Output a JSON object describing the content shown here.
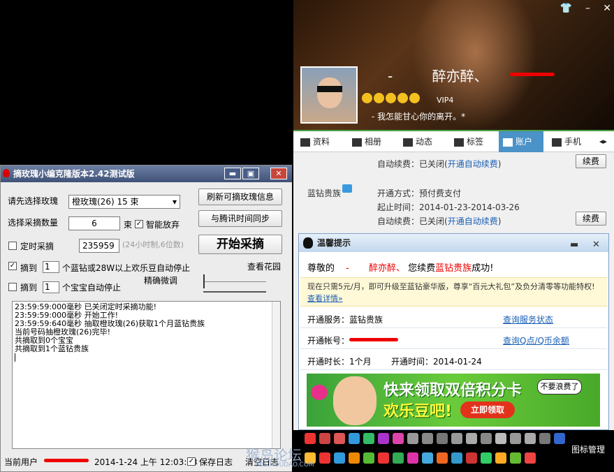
{
  "tool": {
    "title": "摘玫瑰小编克隆版本2.42测试版",
    "select_rose_label": "请先选择玫瑰",
    "select_rose_value": "橙玫瑰(26) 15 束",
    "refresh_button": "刷新可摘玫瑰信息",
    "quantity_label": "选择采摘数量",
    "quantity_value": "6",
    "quantity_unit": "束",
    "smart_give_up": "智能放弃",
    "sync_button": "与腾讯时间同步",
    "timed_pick_label": "定时采摘",
    "timed_value": "235959",
    "timed_hint": "(24小时制,6位数)",
    "start_button": "开始采摘",
    "stop1_prefix": "摘到",
    "stop1_value": "1",
    "stop1_text": "个蓝钻或28W以上欢乐豆自动停止",
    "view_garden": "查看花园",
    "stop2_prefix": "摘到",
    "stop2_value": "1",
    "stop2_text": "个宝宝自动停止",
    "fine_tune": "精确微调",
    "log": [
      "23:59:59:000毫秒 已关闭定时采摘功能!",
      "23:59:59:000毫秒 开始工作!",
      "23:59:59:640毫秒 抽取橙玫瑰(26)获取1个月蓝钻贵族",
      "当前号码抽橙玫瑰(26)完毕!",
      "共摘取到0个宝宝",
      "共摘取到1个蓝钻贵族"
    ],
    "current_user_label": "当前用户",
    "datetime": "2014-1-24 上午 12:03:23",
    "save_log": "保存日志",
    "clear_log": "清空日志"
  },
  "profile": {
    "dash1": "-",
    "nickname": "醉亦醉、",
    "vip": "VIP4",
    "signature": "-   我怎能甘心你的离开。*",
    "top_controls": [
      "👕",
      "–",
      "✕"
    ]
  },
  "tabs": [
    "资料",
    "相册",
    "动态",
    "标签",
    "账户",
    "手机"
  ],
  "account": {
    "auto_renew_label1": "自动续费：",
    "auto_renew_status1": "已关闭(",
    "auto_renew_link1": "开通自动续费",
    "close_paren": ")",
    "renew_button": "续费",
    "blue_diamond": "蓝钻贵族",
    "open_method": "开通方式：预付费支付",
    "period": "起止时间：2014-01-23-2014-03-26",
    "auto_renew_label2": "自动续费：",
    "auto_renew_status2": "已关闭(",
    "auto_renew_link2": "开通自动续费"
  },
  "popup": {
    "title": "温馨提示",
    "greeting_prefix": "尊敬的",
    "greeting_dash": "-",
    "greeting_name": "醉亦醉、",
    "greeting_mid": "您续费",
    "greeting_product": "蓝钻贵族",
    "greeting_suffix": "成功!",
    "notice": "现在只需5元/月，即可升级至蓝钻豪华版，尊享“百元大礼包”及负分清零等功能特权!",
    "notice_link": "查看详情»",
    "service_label": "开通服务：蓝钻贵族",
    "service_link": "查询服务状态",
    "account_label": "开通帐号：",
    "account_link": "查询Q点/Q币余额",
    "duration": "开通时长：1个月",
    "open_time": "开通时间：2014-01-24",
    "banner_line1": "快来领取双倍积分卡",
    "banner_line2": "欢乐豆吧!",
    "banner_button": "立即领取",
    "banner_bubble": "不要浪费了"
  },
  "footer": {
    "icon_manage": "图标管理",
    "watermark": "猴岛论坛",
    "watermark_url": "BBS.HOUDAO.COM"
  },
  "colors": {
    "accent_blue": "#4a92c8",
    "green_line": "#49a349",
    "alert_red": "#e00000",
    "link": "#1a5fb4"
  }
}
